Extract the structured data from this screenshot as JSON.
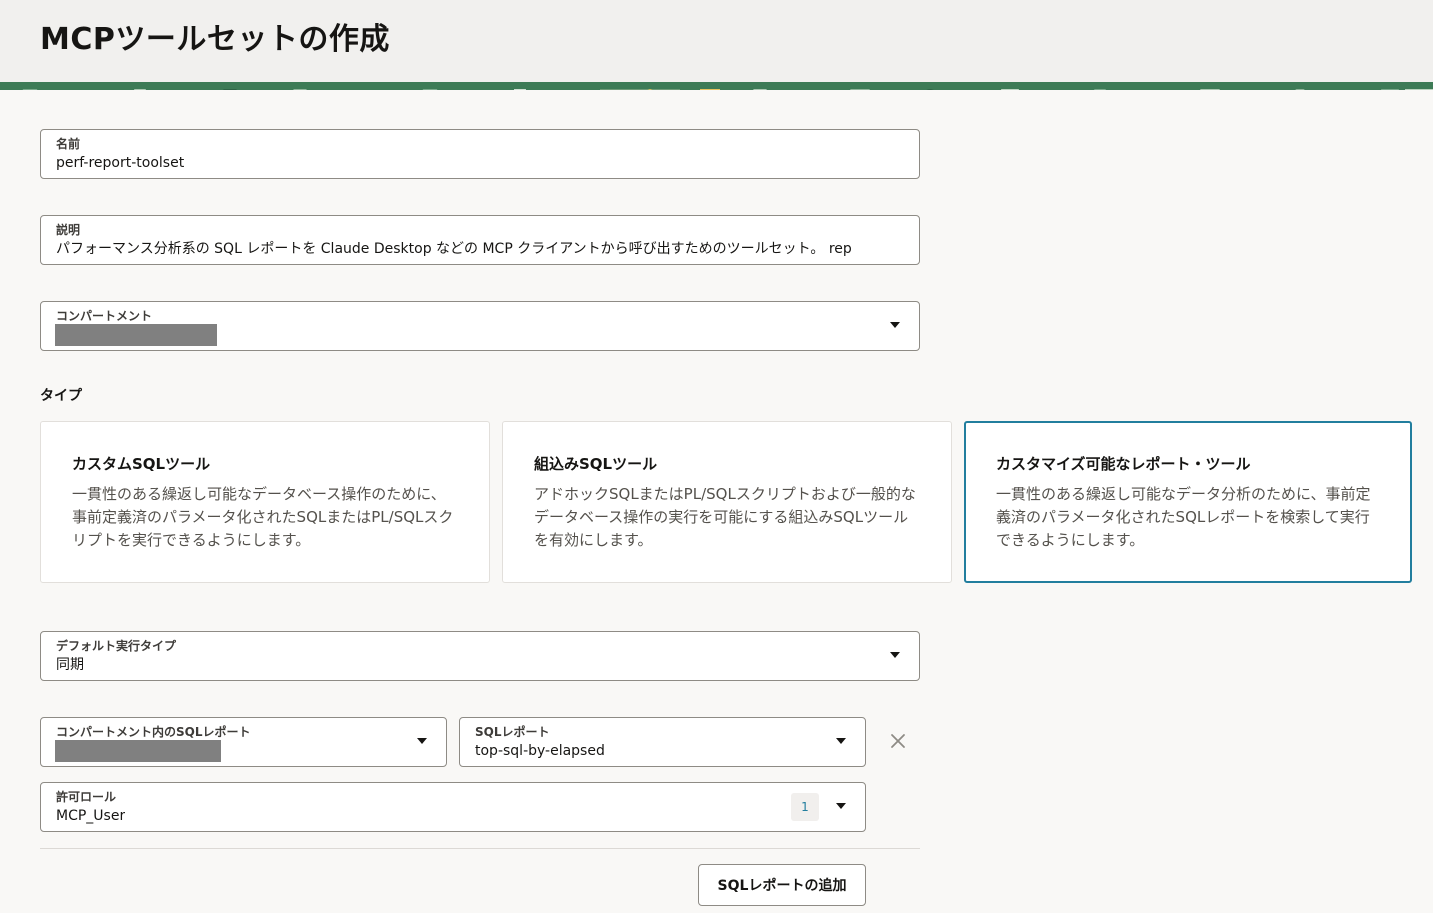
{
  "page": {
    "title": "MCPツールセットの作成"
  },
  "form": {
    "name": {
      "label": "名前",
      "value": "perf-report-toolset"
    },
    "description": {
      "label": "説明",
      "value": "パフォーマンス分析系の SQL レポートを Claude Desktop などの MCP クライアントから呼び出すためのツールセット。 rep"
    },
    "compartment": {
      "label": "コンパートメント",
      "value": ""
    },
    "type": {
      "label": "タイプ",
      "options": [
        {
          "title": "カスタムSQLツール",
          "description": "一貫性のある繰返し可能なデータベース操作のために、事前定義済のパラメータ化されたSQLまたはPL/SQLスクリプトを実行できるようにします。",
          "selected": false
        },
        {
          "title": "組込みSQLツール",
          "description": "アドホックSQLまたはPL/SQLスクリプトおよび一般的なデータベース操作の実行を可能にする組込みSQLツールを有効にします。",
          "selected": false
        },
        {
          "title": "カスタマイズ可能なレポート・ツール",
          "description": "一貫性のある繰返し可能なデータ分析のために、事前定義済のパラメータ化されたSQLレポートを検索して実行できるようにします。",
          "selected": true
        }
      ]
    },
    "default_execution_type": {
      "label": "デフォルト実行タイプ",
      "value": "同期"
    },
    "report_compartment": {
      "label": "コンパートメント内のSQLレポート",
      "value": ""
    },
    "sql_report": {
      "label": "SQLレポート",
      "value": "top-sql-by-elapsed"
    },
    "allowed_roles": {
      "label": "許可ロール",
      "value": "MCP_User",
      "count": "1"
    },
    "add_report_button": "SQLレポートの追加"
  },
  "colors": {
    "selected_border": "#227e9e",
    "banner_green": "#3d7b56",
    "page_background": "#f9f8f6"
  }
}
